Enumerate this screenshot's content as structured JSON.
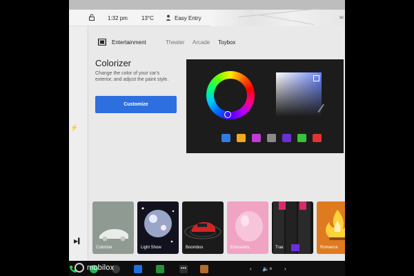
{
  "status": {
    "time": "1:32 pm",
    "temperature": "13°C",
    "profile": "Easy Entry",
    "corner_text": "sc"
  },
  "tabs": {
    "entertainment": "Entertainment",
    "theater": "Theater",
    "arcade": "Arcade",
    "toybox": "Toybox"
  },
  "colorizer": {
    "title": "Colorizer",
    "description": "Change the color of your car's exterior, and adjust the paint style.",
    "cta_label": "Customize",
    "swatch_colors": [
      "#2f7de0",
      "#f2a91e",
      "#c33ad8",
      "#8a8a8a",
      "#6b2fd6",
      "#37c43a",
      "#e23232"
    ]
  },
  "tiles": [
    {
      "label": "Colorizer",
      "color": "#9aa39b"
    },
    {
      "label": "Light Show",
      "color": "#1a1a2e"
    },
    {
      "label": "Boombox",
      "color": "#1e1e1e"
    },
    {
      "label": "Emissions",
      "color": "#f3a6c4"
    },
    {
      "label": "Trax",
      "color": "#181818"
    },
    {
      "label": "Romance",
      "color": "#e0781f"
    }
  ],
  "dock": {
    "brand": "mobilox",
    "icons": [
      "phone-icon",
      "spotify-icon",
      "camera-icon",
      "bluetooth-icon",
      "chart-icon",
      "more-icon",
      "apps-icon",
      "chevron-left-icon",
      "mute-icon",
      "chevron-right-icon"
    ]
  }
}
